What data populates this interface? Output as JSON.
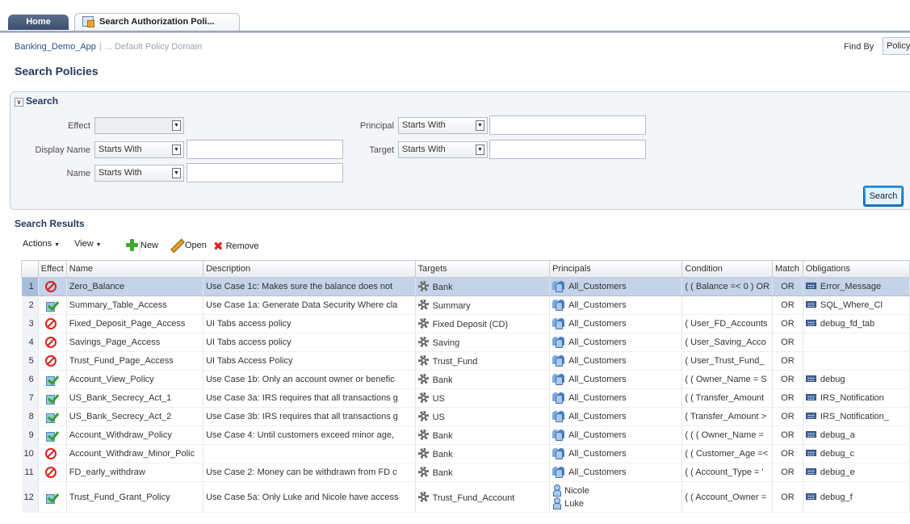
{
  "tabs": {
    "home": "Home",
    "active": "Search Authorization Poli..."
  },
  "breadcrumb": {
    "app": "Banking_Demo_App",
    "domain": "... Default Policy Domain"
  },
  "find_by": {
    "label": "Find By",
    "value": "Policy"
  },
  "page_title": "Search Policies",
  "search": {
    "header": "Search",
    "effect_label": "Effect",
    "effect_value": "",
    "display_name_label": "Display Name",
    "display_name_op": "Starts With",
    "display_name_value": "",
    "name_label": "Name",
    "name_op": "Starts With",
    "name_value": "",
    "principal_label": "Principal",
    "principal_op": "Starts With",
    "principal_value": "",
    "target_label": "Target",
    "target_op": "Starts With",
    "target_value": "",
    "button": "Search"
  },
  "results": {
    "title": "Search Results",
    "toolbar": {
      "actions": "Actions",
      "view": "View",
      "new": "New",
      "open": "Open",
      "remove": "Remove"
    },
    "columns": [
      "Effect",
      "Name",
      "Description",
      "Targets",
      "Principals",
      "Condition",
      "Match",
      "Obligations"
    ],
    "rows": [
      {
        "num": "1",
        "effect": "deny",
        "name": "Zero_Balance",
        "description": "Use Case 1c: Makes sure the balance does not",
        "target": "Bank",
        "principals": [
          "All_Customers"
        ],
        "principal_icon": "group",
        "condition": "( ( Balance =< 0 ) OR",
        "match": "OR",
        "obligation": "Error_Message"
      },
      {
        "num": "2",
        "effect": "grant",
        "name": "Summary_Table_Access",
        "description": "Use Case 1a: Generate Data Security Where cla",
        "target": "Summary",
        "principals": [
          "All_Customers"
        ],
        "principal_icon": "group",
        "condition": "",
        "match": "OR",
        "obligation": "SQL_Where_Cl"
      },
      {
        "num": "3",
        "effect": "deny",
        "name": "Fixed_Deposit_Page_Access",
        "description": "UI Tabs access policy",
        "target": "Fixed Deposit (CD)",
        "principals": [
          "All_Customers"
        ],
        "principal_icon": "group",
        "condition": "( User_FD_Accounts",
        "match": "OR",
        "obligation": "debug_fd_tab"
      },
      {
        "num": "4",
        "effect": "deny",
        "name": "Savings_Page_Access",
        "description": "UI Tabs access policy",
        "target": "Saving",
        "principals": [
          "All_Customers"
        ],
        "principal_icon": "group",
        "condition": "( User_Saving_Acco",
        "match": "OR",
        "obligation": ""
      },
      {
        "num": "5",
        "effect": "deny",
        "name": "Trust_Fund_Page_Access",
        "description": "UI Tabs Access Policy",
        "target": "Trust_Fund",
        "principals": [
          "All_Customers"
        ],
        "principal_icon": "group",
        "condition": "( User_Trust_Fund_",
        "match": "OR",
        "obligation": ""
      },
      {
        "num": "6",
        "effect": "grant",
        "name": "Account_View_Policy",
        "description": "Use Case 1b: Only an account owner or benefic",
        "target": "Bank",
        "principals": [
          "All_Customers"
        ],
        "principal_icon": "group",
        "condition": "( ( Owner_Name = S",
        "match": "OR",
        "obligation": "debug"
      },
      {
        "num": "7",
        "effect": "grant",
        "name": "US_Bank_Secrecy_Act_1",
        "description": "Use Case 3a: IRS requires that all transactions g",
        "target": "US",
        "principals": [
          "All_Customers"
        ],
        "principal_icon": "group",
        "condition": "( ( Transfer_Amount",
        "match": "OR",
        "obligation": "IRS_Notification"
      },
      {
        "num": "8",
        "effect": "grant",
        "name": "US_Bank_Secrecy_Act_2",
        "description": "Use Case 3b: IRS requires that all transactions g",
        "target": "US",
        "principals": [
          "All_Customers"
        ],
        "principal_icon": "group",
        "condition": "( Transfer_Amount >",
        "match": "OR",
        "obligation": "IRS_Notification_"
      },
      {
        "num": "9",
        "effect": "grant",
        "name": "Account_Withdraw_Policy",
        "description": "Use Case 4: Until customers exceed minor age,",
        "target": "Bank",
        "principals": [
          "All_Customers"
        ],
        "principal_icon": "group",
        "condition": "( ( ( Owner_Name =",
        "match": "OR",
        "obligation": "debug_a"
      },
      {
        "num": "10",
        "effect": "deny",
        "name": "Account_Withdraw_Minor_Polic",
        "description": "",
        "target": "Bank",
        "principals": [
          "All_Customers"
        ],
        "principal_icon": "group",
        "condition": "( ( Customer_Age =<",
        "match": "OR",
        "obligation": "debug_c"
      },
      {
        "num": "11",
        "effect": "deny",
        "name": "FD_early_withdraw",
        "description": "Use Case 2: Money can be withdrawn from FD c",
        "target": "Bank",
        "principals": [
          "All_Customers"
        ],
        "principal_icon": "group",
        "condition": "( ( Account_Type = '",
        "match": "OR",
        "obligation": "debug_e"
      },
      {
        "num": "12",
        "effect": "grant",
        "name": "Trust_Fund_Grant_Policy",
        "description": "Use Case 5a: Only Luke and Nicole have access",
        "target": "Trust_Fund_Account",
        "principals": [
          "Nicole",
          "Luke"
        ],
        "principal_icon": "user",
        "condition": "( ( Account_Owner =",
        "match": "OR",
        "obligation": "debug_f"
      }
    ]
  }
}
